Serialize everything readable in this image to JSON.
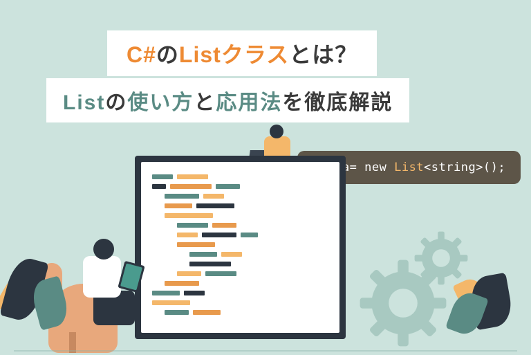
{
  "title_line1": {
    "part1": "C#",
    "part2": "の",
    "part3": "Listクラス",
    "part4": "とは？"
  },
  "title_line2": {
    "part1": "List",
    "part2": "の",
    "part3": "使い方",
    "part4": "と",
    "part5": "応用法",
    "part6": "を徹底解説"
  },
  "code_bubble": {
    "prefix": "var a= new ",
    "keyword": "List",
    "suffix": "<string>();"
  }
}
